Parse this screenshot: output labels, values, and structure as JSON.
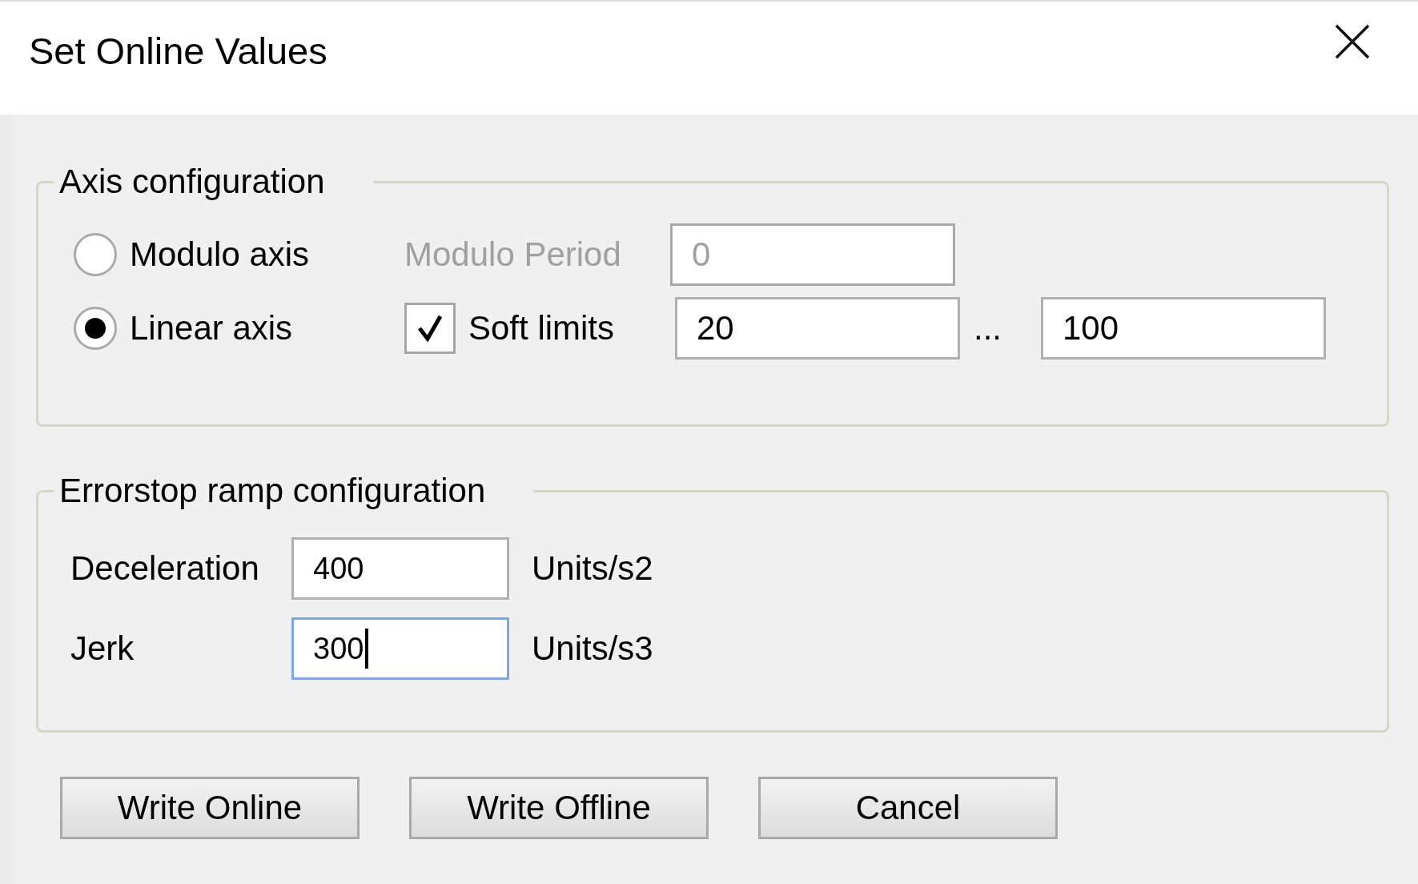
{
  "window": {
    "title": "Set Online Values"
  },
  "axis_configuration": {
    "title": "Axis configuration",
    "options": [
      {
        "label": "Modulo axis",
        "selected": false
      },
      {
        "label": "Linear axis",
        "selected": true
      }
    ],
    "modulo_period": {
      "label": "Modulo Period",
      "value": "0",
      "disabled": true
    },
    "soft_limits": {
      "label": "Soft limits",
      "checked": true,
      "min": "20",
      "separator": "...",
      "max": "100"
    }
  },
  "errorstop_ramp": {
    "title": "Errorstop ramp configuration",
    "rows": [
      {
        "label": "Deceleration",
        "value": "400",
        "unit": "Units/s2",
        "focused": false
      },
      {
        "label": "Jerk",
        "value": "300",
        "unit": "Units/s3",
        "focused": true
      }
    ]
  },
  "buttons": [
    "Write Online",
    "Write Offline",
    "Cancel"
  ]
}
